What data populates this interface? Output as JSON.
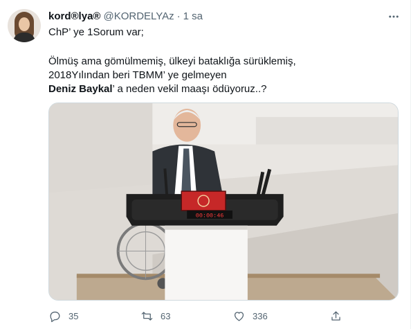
{
  "tweet": {
    "author_name": "kord®lya®",
    "handle": "@KORDELYAz",
    "separator": "·",
    "time": "1 sa",
    "line1": "ChP’ ye 1Sorum var;",
    "line2": "Ölmüş ama gömülmemiş, ülkeyi bataklığa sürüklemiş,",
    "line3": "2018Yılından beri TBMM’ ye gelmeyen",
    "line4_bold": "Deniz Baykal",
    "line4_rest": "’ a neden vekil maaşı ödüyoruz..?",
    "media_counter": "00:00:46"
  },
  "actions": {
    "replies": "35",
    "retweets": "63",
    "likes": "336"
  },
  "colors": {
    "text": "#0f1419",
    "secondary": "#536471",
    "border": "#cfd9de",
    "podium_red": "#c62828"
  }
}
